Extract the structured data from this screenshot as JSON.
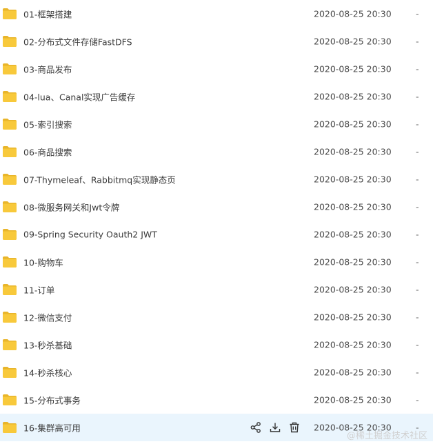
{
  "colors": {
    "folder_fill": "#f8c93b",
    "folder_tab": "#e9b52a",
    "hover_row": "#eaf5fd",
    "text": "#3a3a3a",
    "icon_stroke": "#333333"
  },
  "files": [
    {
      "name": "01-框架搭建",
      "date": "2020-08-25 20:30",
      "size": "-",
      "icon": "folder-icon"
    },
    {
      "name": "02-分布式文件存储FastDFS",
      "date": "2020-08-25 20:30",
      "size": "-",
      "icon": "folder-icon"
    },
    {
      "name": "03-商品发布",
      "date": "2020-08-25 20:30",
      "size": "-",
      "icon": "folder-icon"
    },
    {
      "name": "04-lua、Canal实现广告缓存",
      "date": "2020-08-25 20:30",
      "size": "-",
      "icon": "folder-icon"
    },
    {
      "name": "05-索引搜索",
      "date": "2020-08-25 20:30",
      "size": "-",
      "icon": "folder-icon"
    },
    {
      "name": "06-商品搜索",
      "date": "2020-08-25 20:30",
      "size": "-",
      "icon": "folder-icon"
    },
    {
      "name": "07-Thymeleaf、Rabbitmq实现静态页",
      "date": "2020-08-25 20:30",
      "size": "-",
      "icon": "folder-icon"
    },
    {
      "name": "08-微服务网关和Jwt令牌",
      "date": "2020-08-25 20:30",
      "size": "-",
      "icon": "folder-icon"
    },
    {
      "name": "09-Spring Security Oauth2 JWT",
      "date": "2020-08-25 20:30",
      "size": "-",
      "icon": "folder-icon"
    },
    {
      "name": "10-购物车",
      "date": "2020-08-25 20:30",
      "size": "-",
      "icon": "folder-icon"
    },
    {
      "name": "11-订单",
      "date": "2020-08-25 20:30",
      "size": "-",
      "icon": "folder-icon"
    },
    {
      "name": "12-微信支付",
      "date": "2020-08-25 20:30",
      "size": "-",
      "icon": "folder-icon"
    },
    {
      "name": "13-秒杀基础",
      "date": "2020-08-25 20:30",
      "size": "-",
      "icon": "folder-icon"
    },
    {
      "name": "14-秒杀核心",
      "date": "2020-08-25 20:30",
      "size": "-",
      "icon": "folder-icon"
    },
    {
      "name": "15-分布式事务",
      "date": "2020-08-25 20:30",
      "size": "-",
      "icon": "folder-icon"
    },
    {
      "name": "16-集群高可用",
      "date": "2020-08-25 20:30",
      "size": "-",
      "icon": "folder-icon",
      "hovered": true
    }
  ],
  "hover_actions": [
    {
      "icon": "share-icon"
    },
    {
      "icon": "download-icon"
    },
    {
      "icon": "delete-icon"
    }
  ],
  "watermark": "@稀土掘金技术社区"
}
